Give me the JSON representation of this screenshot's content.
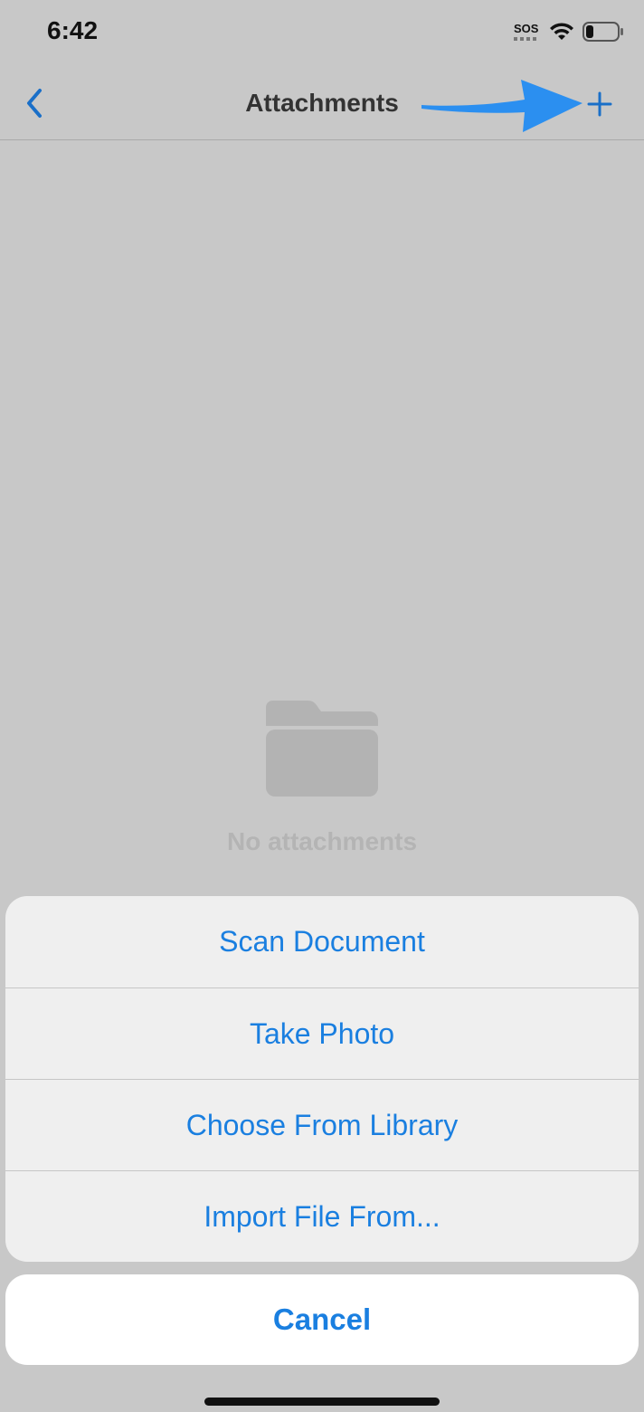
{
  "status_bar": {
    "time": "6:42",
    "sos_label": "SOS"
  },
  "nav": {
    "title": "Attachments",
    "back_icon": "chevron-left-icon",
    "add_icon": "plus-icon"
  },
  "empty_state": {
    "icon": "folder-icon",
    "message": "No attachments"
  },
  "action_sheet": {
    "items": [
      {
        "label": "Scan Document"
      },
      {
        "label": "Take Photo"
      },
      {
        "label": "Choose From Library"
      },
      {
        "label": "Import File From..."
      }
    ],
    "cancel_label": "Cancel"
  },
  "colors": {
    "accent": "#1a7fe0",
    "annotation_arrow": "#2b8ff0",
    "background_dimmed": "#c8c8c8"
  }
}
